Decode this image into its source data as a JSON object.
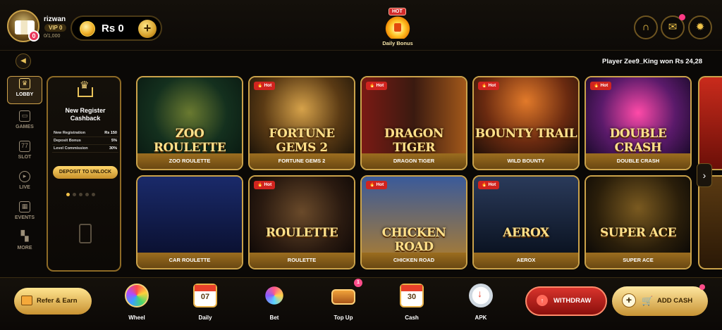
{
  "header": {
    "user_name": "rizwan",
    "avatar_badge": "0",
    "vip_label": "VIP 0",
    "vip_progress": "0/1,000",
    "currency": "Rs",
    "balance": "Rs 0",
    "add_label": "+",
    "daily_bonus": {
      "tag": "HOT",
      "label": "Daily Bonus"
    }
  },
  "ticker": {
    "text": "Player Zee9_King won Rs 24,28"
  },
  "sidebar": {
    "items": [
      {
        "label": "LOBBY",
        "icon": "crown-icon",
        "active": true
      },
      {
        "label": "GAMES",
        "icon": "slot-machine-icon"
      },
      {
        "label": "SLOT",
        "icon": "777-icon"
      },
      {
        "label": "LIVE",
        "icon": "play-icon"
      },
      {
        "label": "EVENTS",
        "icon": "calendar-icon"
      },
      {
        "label": "MORE",
        "icon": "grid-icon"
      }
    ]
  },
  "promo": {
    "title": "New Register Cashback",
    "rows": [
      {
        "label": "New Registration",
        "value": "Rs 150"
      },
      {
        "label": "Deposit Bonus",
        "value": "5%"
      },
      {
        "label": "Level Commission",
        "value": "30%"
      }
    ],
    "button": "DEPOSIT TO UNLOCK",
    "dots_total": 5,
    "dots_active": 0
  },
  "games": [
    {
      "name": "ZOO ROULETTE",
      "art_title": "ZOO ROULETTE",
      "hot": false
    },
    {
      "name": "FORTUNE GEMS 2",
      "art_title": "FORTUNE GEMS 2",
      "hot": true
    },
    {
      "name": "DRAGON TIGER",
      "art_title": "DRAGON TIGER",
      "hot": true
    },
    {
      "name": "WILD BOUNTY",
      "art_title": "BOUNTY TRAIL",
      "hot": true
    },
    {
      "name": "DOUBLE CRASH",
      "art_title": "DOUBLE CRASH",
      "hot": true
    },
    {
      "name": "CAR ROULETTE",
      "art_title": "",
      "hot": false
    },
    {
      "name": "ROULETTE",
      "art_title": "ROULETTE",
      "hot": true
    },
    {
      "name": "CHICKEN ROAD",
      "art_title": "CHICKEN ROAD",
      "hot": true
    },
    {
      "name": "AEROX",
      "art_title": "AEROX",
      "hot": true
    },
    {
      "name": "SUPER ACE",
      "art_title": "SUPER ACE",
      "hot": false
    }
  ],
  "hot_label": "Hot",
  "bottom": {
    "refer": "Refer & Earn",
    "nav": [
      {
        "label": "Wheel",
        "icon": "wheel-icon"
      },
      {
        "label": "Daily",
        "icon": "calendar-icon",
        "value": "07"
      },
      {
        "label": "Bet",
        "icon": "fan-icon"
      },
      {
        "label": "Top Up",
        "icon": "treasure-chest-icon",
        "badge": "1"
      },
      {
        "label": "Cash",
        "icon": "calendar-icon",
        "value": "30"
      },
      {
        "label": "APK",
        "icon": "download-icon"
      }
    ],
    "withdraw": "WITHDRAW",
    "add_cash": "ADD CASH"
  },
  "colors": {
    "accent": "#caa24a",
    "gold": "#f3d27a",
    "hot": "#d0241f",
    "withdraw": "#d8332c"
  }
}
